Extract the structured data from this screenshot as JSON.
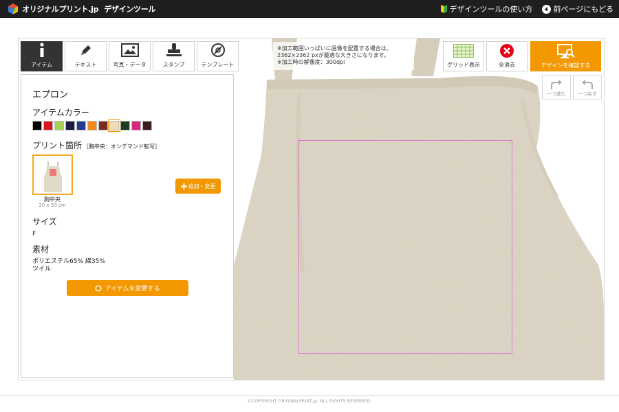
{
  "header": {
    "logo_text": "オリジナルプリント.jp",
    "logo_subtitle": "デザインツール",
    "howto_link": "デザインツールの使い方",
    "back_link": "前ページにもどる"
  },
  "tool_tabs": [
    {
      "label": "アイテム",
      "icon": "info-icon",
      "active": true
    },
    {
      "label": "テキスト",
      "icon": "pen-icon",
      "active": false
    },
    {
      "label": "写真・データ",
      "icon": "image-icon",
      "active": false
    },
    {
      "label": "スタンプ",
      "icon": "stamp-icon",
      "active": false
    },
    {
      "label": "テンプレート",
      "icon": "template-icon",
      "active": false
    }
  ],
  "panel": {
    "item_name": "エプロン",
    "color_heading": "アイテムカラー",
    "colors": [
      "#000000",
      "#d7171f",
      "#a9cf54",
      "#1b1b44",
      "#233a91",
      "#f28a1d",
      "#7a2c22",
      "#f2dcb5",
      "#1f3a24",
      "#d6287d",
      "#3a1e1e"
    ],
    "selected_color_index": 7,
    "print_heading": "プリント箇所",
    "print_note": "［胸中央：オンデマンド転写］",
    "location_label": "胸中央",
    "location_size": "20 x 20 cm",
    "add_button": "追加・変更",
    "size_heading": "サイズ",
    "size_value": "F",
    "material_heading": "素材",
    "material_line1": "ポリエステル65% 綿35%",
    "material_line2": "ツイル",
    "change_button": "アイテムを変更する"
  },
  "notice": {
    "line1": "※加工範囲いっぱいに画像を配置する場合は、",
    "line2": "2362×2362 pxが最適な大きさになります。",
    "line3": "※加工時の解像度：300dpi"
  },
  "toolbar": {
    "grid_label": "グリッド表示",
    "clear_label": "全消去",
    "confirm_label": "デザインを確認する",
    "redo_label": "一つ進む",
    "undo_label": "一つ戻す"
  },
  "colors": {
    "accent": "#f39800",
    "header_bg": "#1e1e1e",
    "apron": "#ddd5c5",
    "print_area_border": "#d876c9",
    "clear_icon": "#e60012"
  },
  "footer": {
    "copyright": "©COPYRIGHT ORIGINALPRINT.jp. ALL RIGHTS RESERVED."
  }
}
